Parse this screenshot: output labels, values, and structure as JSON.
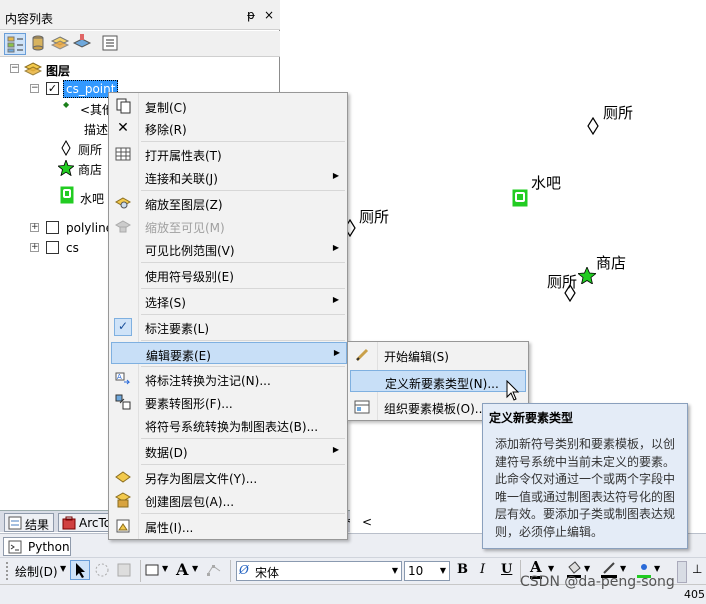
{
  "toc": {
    "title": "内容列表",
    "pin": "ᵽ",
    "close": "×",
    "root_layer": "图层",
    "layers": [
      {
        "name": "cs_point",
        "checked": true
      },
      {
        "name": "polyline",
        "checked": false
      },
      {
        "name": "cs",
        "checked": false
      }
    ],
    "legend_other": "<其他",
    "legend_desc": "描述",
    "legend_items": [
      "厕所",
      "商店",
      "水吧"
    ]
  },
  "bottom_tabs": [
    "结果",
    "ArcTo"
  ],
  "python_tab": "Python",
  "map_labels": {
    "toilet_1": "厕所",
    "water": "水吧",
    "toilet_2": "厕所",
    "shop": "商店",
    "toilet_3": "厕所"
  },
  "context_menu": {
    "items": [
      {
        "label": "复制(C)",
        "icon": "copy-icon"
      },
      {
        "label": "移除(R)",
        "icon": "remove-icon"
      },
      {
        "label": "打开属性表(T)",
        "icon": "table-icon"
      },
      {
        "label": "连接和关联(J)",
        "icon": "",
        "submenu": true
      },
      {
        "label": "缩放至图层(Z)",
        "icon": "zoom-layer-icon"
      },
      {
        "label": "缩放至可见(M)",
        "icon": "zoom-visible-icon",
        "disabled": true
      },
      {
        "label": "可见比例范围(V)",
        "icon": "",
        "submenu": true
      },
      {
        "label": "使用符号级别(E)",
        "icon": ""
      },
      {
        "label": "选择(S)",
        "icon": "",
        "submenu": true
      },
      {
        "label": "标注要素(L)",
        "icon": "check-icon"
      },
      {
        "label": "编辑要素(E)",
        "icon": "",
        "submenu": true,
        "highlighted": true
      },
      {
        "label": "将标注转换为注记(N)...",
        "icon": "convert-icon"
      },
      {
        "label": "要素转图形(F)...",
        "icon": "feature-graphic-icon"
      },
      {
        "label": "将符号系统转换为制图表达(B)...",
        "icon": ""
      },
      {
        "label": "数据(D)",
        "icon": "",
        "submenu": true
      },
      {
        "label": "另存为图层文件(Y)...",
        "icon": "layer-file-icon"
      },
      {
        "label": "创建图层包(A)...",
        "icon": "layer-package-icon"
      },
      {
        "label": "属性(I)...",
        "icon": "properties-icon"
      }
    ]
  },
  "submenu": {
    "items": [
      {
        "label": "开始编辑(S)"
      },
      {
        "label": "定义新要素类型(N)...",
        "highlighted": true
      },
      {
        "label": "组织要素模板(O)..."
      }
    ]
  },
  "tooltip": {
    "title": "定义新要素类型",
    "body": "添加新符号类别和要素模板，以创建符号系统中当前未定义的要素。此命令仅对通过一个或两个字段中唯一值或通过制图表达符号化的图层有效。要添加子类或制图表达规则，必须停止编辑。"
  },
  "draw_toolbar": {
    "draw_label": "绘制(D)",
    "font_name": "宋体",
    "font_size": "10",
    "bold": "B",
    "italic": "I",
    "underline": "U",
    "font_color": "A"
  },
  "status": {
    "coord": "405"
  },
  "watermark": "CSDN @da-peng-song",
  "colors": {
    "selection": "#3399ff",
    "menu_highlight": "#c8dff7",
    "green": "#22cc22"
  }
}
